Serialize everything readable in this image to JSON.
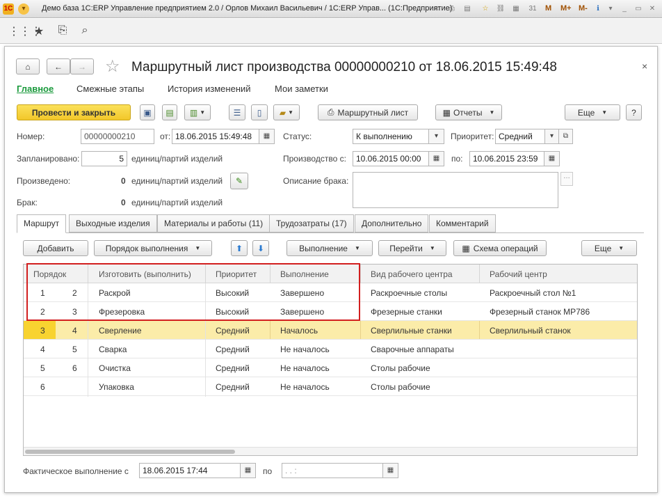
{
  "titlebar": {
    "title": "Демо база 1С:ERP Управление предприятием 2.0 / Орлов Михаил Васильевич / 1С:ERP Управ... (1С:Предприятие)",
    "m_labels": [
      "M",
      "M+",
      "M-"
    ]
  },
  "form": {
    "title": "Маршрутный лист производства 00000000210 от 18.06.2015 15:49:48",
    "nav": [
      "Главное",
      "Смежные этапы",
      "История изменений",
      "Мои заметки"
    ],
    "toolbar": {
      "post_close": "Провести и закрыть",
      "route_sheet": "Маршрутный лист",
      "reports": "Отчеты",
      "more": "Еще",
      "help": "?"
    },
    "fields": {
      "number_label": "Номер:",
      "number_value": "00000000210",
      "date_label": "от:",
      "date_value": "18.06.2015 15:49:48",
      "status_label": "Статус:",
      "status_value": "К выполнению",
      "priority_label": "Приоритет:",
      "priority_value": "Средний",
      "planned_label": "Запланировано:",
      "planned_value": "5",
      "planned_unit": "единиц/партий изделий",
      "production_label": "Производство с:",
      "production_from": "10.06.2015 00:00",
      "production_to_label": "по:",
      "production_to": "10.06.2015 23:59",
      "produced_label": "Произведено:",
      "produced_value": "0",
      "produced_unit": "единиц/партий изделий",
      "defect_desc_label": "Описание брака:",
      "defect_label": "Брак:",
      "defect_value": "0",
      "defect_unit": "единиц/партий изделий"
    },
    "tabs": [
      "Маршрут",
      "Выходные изделия",
      "Материалы и работы (11)",
      "Трудозатраты (17)",
      "Дополнительно",
      "Комментарий"
    ],
    "route_toolbar": {
      "add": "Добавить",
      "order": "Порядок выполнения",
      "execution": "Выполнение",
      "goto": "Перейти",
      "scheme": "Схема операций",
      "more": "Еще"
    },
    "grid": {
      "columns": [
        "Порядок",
        "Изготовить (выполнить)",
        "Приоритет",
        "Выполнение",
        "Вид рабочего центра",
        "Рабочий центр"
      ],
      "rows": [
        {
          "n": "1",
          "m": "2",
          "op": "Раскрой",
          "prio": "Высокий",
          "exec": "Завершено",
          "wct": "Раскроечные столы",
          "wc": "Раскроечный стол №1"
        },
        {
          "n": "2",
          "m": "3",
          "op": "Фрезеровка",
          "prio": "Высокий",
          "exec": "Завершено",
          "wct": "Фрезерные станки",
          "wc": "Фрезерный станок МР786"
        },
        {
          "n": "3",
          "m": "4",
          "op": "Сверление",
          "prio": "Средний",
          "exec": "Началось",
          "wct": "Сверлильные станки",
          "wc": "Сверлильный станок"
        },
        {
          "n": "4",
          "m": "5",
          "op": "Сварка",
          "prio": "Средний",
          "exec": "Не началось",
          "wct": "Сварочные аппараты",
          "wc": ""
        },
        {
          "n": "5",
          "m": "6",
          "op": "Очистка",
          "prio": "Средний",
          "exec": "Не началось",
          "wct": "Столы рабочие",
          "wc": ""
        },
        {
          "n": "6",
          "m": "",
          "op": "Упаковка",
          "prio": "Средний",
          "exec": "Не началось",
          "wct": "Столы рабочие",
          "wc": ""
        }
      ]
    },
    "footer": {
      "actual_label": "Фактическое выполнение с",
      "actual_from": "18.06.2015 17:44",
      "to_label": "по",
      "actual_to": " .  .     :  "
    }
  },
  "colors": {
    "accent_yellow": "#f8d330",
    "selected_row": "#fbeca9",
    "highlight_red": "#d21f1f",
    "nav_active": "#1a9a3c"
  }
}
